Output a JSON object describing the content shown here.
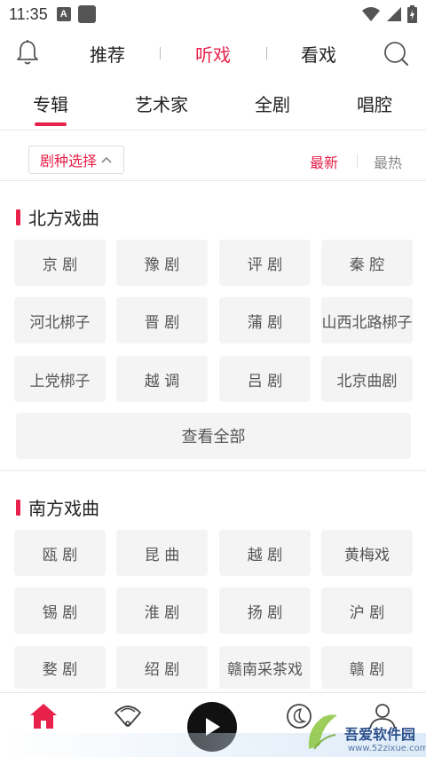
{
  "status_bar": {
    "time": "11:35",
    "a_badge": "A"
  },
  "top_nav": {
    "tabs": [
      "推荐",
      "听戏",
      "看戏"
    ],
    "active_tab": "听戏",
    "accent_color": "#e8214a"
  },
  "sub_tabs": [
    "专辑",
    "艺术家",
    "全剧",
    "唱腔"
  ],
  "filter": {
    "genre_select": "剧种选择",
    "sort_new": "最新",
    "sort_hot": "最热"
  },
  "north": {
    "title": "北方戏曲",
    "items": [
      "京 剧",
      "豫 剧",
      "评 剧",
      "秦 腔",
      "河北梆子",
      "晋 剧",
      "蒲 剧",
      "山西北路梆子",
      "上党梆子",
      "越 调",
      "吕 剧",
      "北京曲剧"
    ],
    "view_all": "查看全部"
  },
  "south": {
    "title": "南方戏曲",
    "items": [
      "瓯 剧",
      "昆 曲",
      "越 剧",
      "黄梅戏",
      "锡 剧",
      "淮 剧",
      "扬 剧",
      "沪 剧",
      "婺 剧",
      "绍 剧",
      "赣南采茶戏",
      "赣 剧"
    ]
  },
  "watermark": {
    "title": "吾爱软件园",
    "url": "www.52zixue.com"
  }
}
